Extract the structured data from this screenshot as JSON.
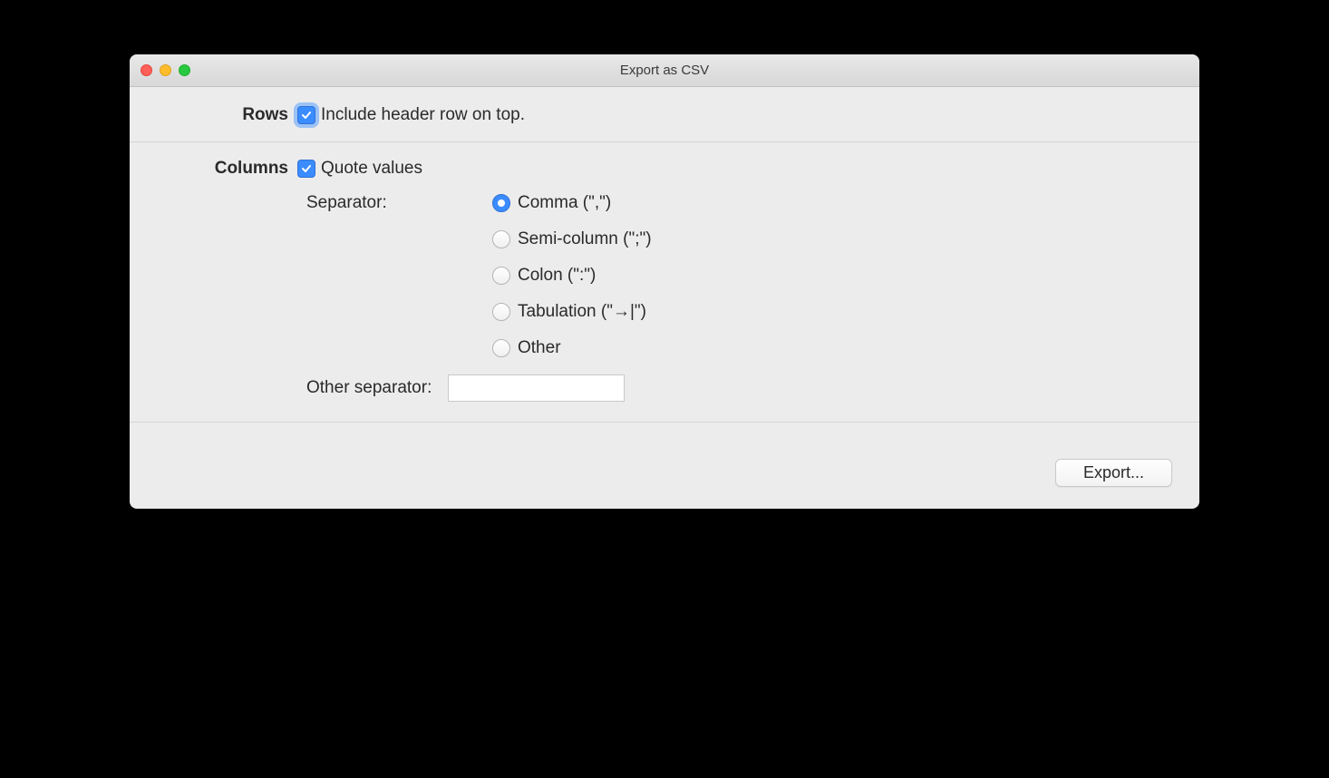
{
  "window": {
    "title": "Export as CSV"
  },
  "rows": {
    "section_label": "Rows",
    "include_header": {
      "checked": true,
      "focused": true,
      "label": "Include header row on top."
    }
  },
  "columns": {
    "section_label": "Columns",
    "quote_values": {
      "checked": true,
      "label": "Quote values"
    },
    "separator_label": "Separator:",
    "separator_options": [
      {
        "label": "Comma (\",\")",
        "selected": true
      },
      {
        "label": "Semi-column (\";\")",
        "selected": false
      },
      {
        "label": "Colon (\":\")",
        "selected": false
      },
      {
        "label": "Tabulation (\"→|\")",
        "selected": false
      },
      {
        "label": "Other",
        "selected": false
      }
    ],
    "other_separator_label": "Other separator:",
    "other_separator_value": ""
  },
  "footer": {
    "export_button": "Export..."
  }
}
